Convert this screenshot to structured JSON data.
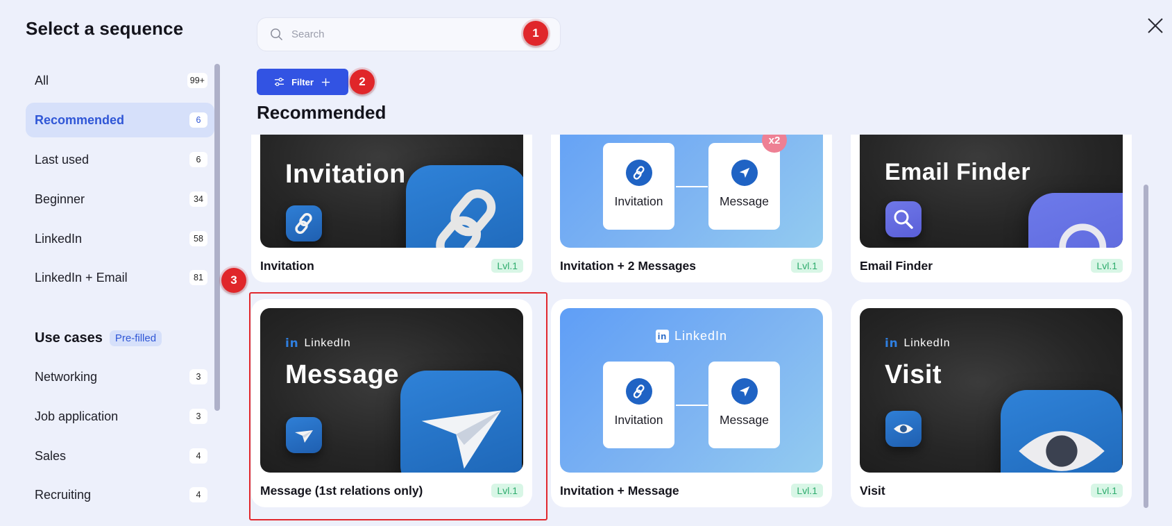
{
  "dialog": {
    "title": "Select a sequence"
  },
  "search": {
    "placeholder": "Search"
  },
  "filter": {
    "label": "Filter"
  },
  "sidebar": {
    "items": [
      {
        "label": "All",
        "count": "99+"
      },
      {
        "label": "Recommended",
        "count": "6",
        "active": true
      },
      {
        "label": "Last used",
        "count": "6"
      },
      {
        "label": "Beginner",
        "count": "34"
      },
      {
        "label": "LinkedIn",
        "count": "58"
      },
      {
        "label": "LinkedIn + Email",
        "count": "81"
      }
    ],
    "use_cases": {
      "title": "Use cases",
      "badge": "Pre-filled",
      "items": [
        {
          "label": "Networking",
          "count": "3"
        },
        {
          "label": "Job application",
          "count": "3"
        },
        {
          "label": "Sales",
          "count": "4"
        },
        {
          "label": "Recruiting",
          "count": "4"
        }
      ]
    }
  },
  "main": {
    "section_title": "Recommended",
    "cards": [
      {
        "name": "Invitation",
        "level": "Lvl.1",
        "thumb_title": "Invitation"
      },
      {
        "name": "Invitation + 2 Messages",
        "level": "Lvl.1",
        "step1": "Invitation",
        "step2": "Message",
        "repeat_badge": "x2"
      },
      {
        "name": "Email Finder",
        "level": "Lvl.1",
        "thumb_title": "Email Finder"
      },
      {
        "name": "Message (1st relations only)",
        "level": "Lvl.1",
        "brand": "LinkedIn",
        "thumb_title": "Message"
      },
      {
        "name": "Invitation + Message",
        "level": "Lvl.1",
        "brand": "LinkedIn",
        "step1": "Invitation",
        "step2": "Message"
      },
      {
        "name": "Visit",
        "level": "Lvl.1",
        "brand": "LinkedIn",
        "thumb_title": "Visit"
      }
    ]
  },
  "annotations": {
    "marker1": "1",
    "marker2": "2",
    "marker3": "3"
  },
  "colors": {
    "background": "#edf0fb",
    "accent": "#3253e3",
    "active_nav_bg": "#d6e0fa",
    "level_badge_bg": "#d8f6e6",
    "level_badge_text": "#2dab6c",
    "annotation_red": "#e0262a",
    "linkedin_blue": "#1f63c4"
  }
}
